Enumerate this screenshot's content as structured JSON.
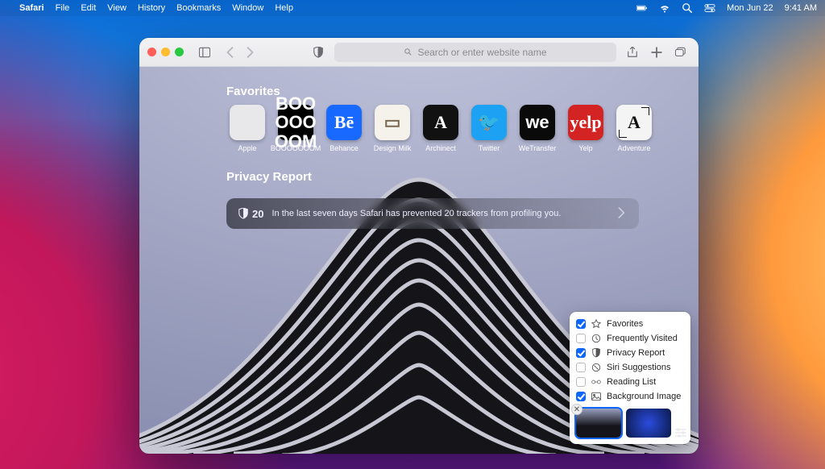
{
  "menubar": {
    "app_name": "Safari",
    "menus": [
      "File",
      "Edit",
      "View",
      "History",
      "Bookmarks",
      "Window",
      "Help"
    ],
    "date": "Mon Jun 22",
    "time": "9:41 AM"
  },
  "toolbar": {
    "search_placeholder": "Search or enter website name"
  },
  "sections": {
    "favorites_title": "Favorites",
    "privacy_title": "Privacy Report"
  },
  "favorites": [
    {
      "label": "Apple",
      "tile_class": "tile-apple",
      "glyph": ""
    },
    {
      "label": "BOOOOOOOM",
      "tile_class": "tile-boo",
      "glyph": "BOO\nOOO\nOOM"
    },
    {
      "label": "Behance",
      "tile_class": "tile-behance",
      "glyph": "Bē"
    },
    {
      "label": "Design Milk",
      "tile_class": "tile-dmilk",
      "glyph": "▭"
    },
    {
      "label": "Archinect",
      "tile_class": "tile-arch",
      "glyph": "A"
    },
    {
      "label": "Twitter",
      "tile_class": "tile-twitter",
      "glyph": "🐦"
    },
    {
      "label": "WeTransfer",
      "tile_class": "tile-wet",
      "glyph": "we"
    },
    {
      "label": "Yelp",
      "tile_class": "tile-yelp",
      "glyph": "yelp"
    },
    {
      "label": "Adventure",
      "tile_class": "tile-adv",
      "glyph": "A"
    }
  ],
  "privacy": {
    "count": "20",
    "message": "In the last seven days Safari has prevented 20 trackers from profiling you."
  },
  "popover": {
    "items": [
      {
        "label": "Favorites",
        "checked": true,
        "icon": "star"
      },
      {
        "label": "Frequently Visited",
        "checked": false,
        "icon": "clock"
      },
      {
        "label": "Privacy Report",
        "checked": true,
        "icon": "shield"
      },
      {
        "label": "Siri Suggestions",
        "checked": false,
        "icon": "siri"
      },
      {
        "label": "Reading List",
        "checked": false,
        "icon": "glasses"
      },
      {
        "label": "Background Image",
        "checked": true,
        "icon": "image"
      }
    ]
  }
}
